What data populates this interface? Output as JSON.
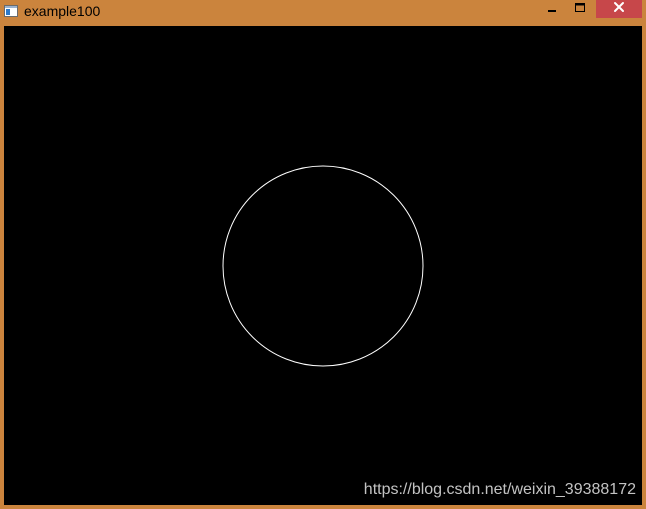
{
  "window": {
    "title": "example100",
    "frame_color": "#CB843D",
    "close_color": "#C7474A"
  },
  "titlebar": {
    "icon": "app-window-icon",
    "minimize_icon": "minimize-icon",
    "maximize_icon": "maximize-icon",
    "close_icon": "close-icon"
  },
  "canvas": {
    "background": "#000000",
    "shape": "circle",
    "stroke_color": "#FFFFFF"
  },
  "watermark": {
    "text": "https://blog.csdn.net/weixin_39388172"
  }
}
